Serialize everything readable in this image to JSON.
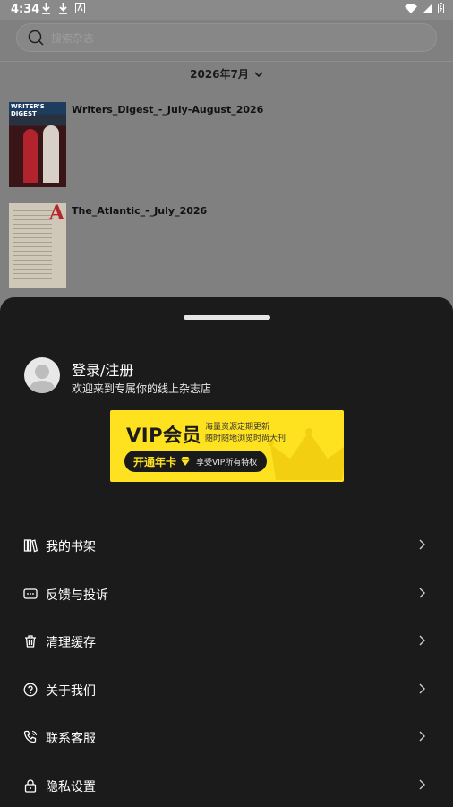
{
  "status_bar": {
    "time": "4:34"
  },
  "search": {
    "placeholder": "搜索杂志"
  },
  "filter": {
    "month": "2026年7月"
  },
  "magazines": [
    {
      "title": "Writers_Digest_-_July-August_2026",
      "cover_text": "WRITER'S DIGEST"
    },
    {
      "title": "The_Atlantic_-_July_2026",
      "cover_text": "A"
    }
  ],
  "profile": {
    "login_label": "登录/注册",
    "subtitle": "欢迎来到专属你的线上杂志店"
  },
  "vip": {
    "title": "VIP会员",
    "desc_line1": "海量资源定期更新",
    "desc_line2": "随时随地浏览时尚大刊",
    "button_label": "开通年卡",
    "button_sub": "享受VIP所有特权",
    "colors": {
      "accent": "#ffe21f",
      "dark": "#1a1a1a"
    }
  },
  "menu": [
    {
      "label": "我的书架",
      "icon": "bookshelf-icon"
    },
    {
      "label": "反馈与投诉",
      "icon": "feedback-icon"
    },
    {
      "label": "清理缓存",
      "icon": "trash-icon"
    },
    {
      "label": "关于我们",
      "icon": "help-circle-icon"
    },
    {
      "label": "联系客服",
      "icon": "phone-icon"
    },
    {
      "label": "隐私设置",
      "icon": "lock-icon"
    }
  ]
}
